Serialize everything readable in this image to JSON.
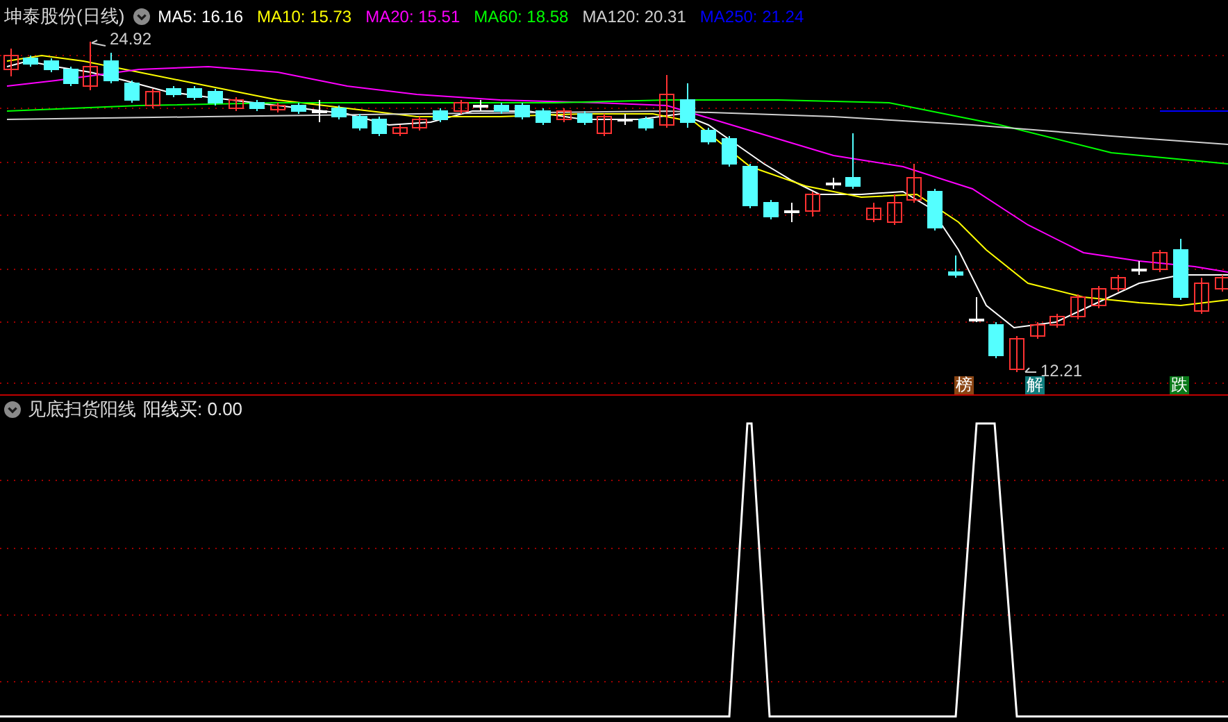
{
  "stock_title": "坤泰股份(日线)",
  "ma_legend": [
    {
      "label": "MA5: 16.16",
      "color": "#ffffff"
    },
    {
      "label": "MA10: 15.73",
      "color": "#ffff00"
    },
    {
      "label": "MA20: 15.51",
      "color": "#ff00ff"
    },
    {
      "label": "MA60: 18.58",
      "color": "#00ff00"
    },
    {
      "label": "MA120: 20.31",
      "color": "#d0d0d0"
    },
    {
      "label": "MA250: 21.24",
      "color": "#0000ff"
    }
  ],
  "high_label": "24.92",
  "low_label": "12.21",
  "event_badges": [
    {
      "text": "榜",
      "color": "#8b4513"
    },
    {
      "text": "解",
      "color": "#0f7c7c"
    },
    {
      "text": "跌",
      "color": "#0a7a1a"
    }
  ],
  "indicator": {
    "title": "见底扫货阳线",
    "reading": "阳线买: 0.00"
  }
}
